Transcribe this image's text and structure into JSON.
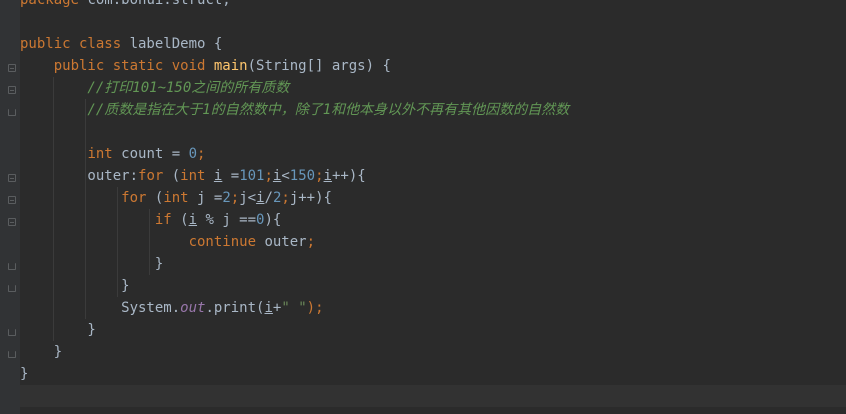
{
  "editor": {
    "lines": [
      [
        {
          "t": "package ",
          "c": "kw"
        },
        {
          "t": "com.bohui.struct;",
          "c": "var"
        }
      ],
      [],
      [
        {
          "t": "public class ",
          "c": "kw"
        },
        {
          "t": "labelDemo {",
          "c": "var"
        }
      ],
      [
        {
          "t": "    public static void ",
          "c": "kw"
        },
        {
          "t": "main",
          "c": "fn"
        },
        {
          "t": "(String[] args) {",
          "c": "var"
        }
      ],
      [
        {
          "t": "        //打印101~150之间的所有质数",
          "c": "cm"
        }
      ],
      [
        {
          "t": "        //质数是指在大于1的自然数中，除了1和他本身以外不再有其他因数的自然数",
          "c": "cm"
        }
      ],
      [],
      [
        {
          "t": "        ",
          "c": "var"
        },
        {
          "t": "int ",
          "c": "kw"
        },
        {
          "t": "count = ",
          "c": "var"
        },
        {
          "t": "0",
          "c": "num"
        },
        {
          "t": ";",
          "c": "kw"
        }
      ],
      [
        {
          "t": "        outer:",
          "c": "var"
        },
        {
          "t": "for ",
          "c": "kw"
        },
        {
          "t": "(",
          "c": "var"
        },
        {
          "t": "int ",
          "c": "kw"
        },
        {
          "t": "i",
          "c": "var ul"
        },
        {
          "t": " =",
          "c": "var"
        },
        {
          "t": "101",
          "c": "num"
        },
        {
          "t": ";",
          "c": "kw"
        },
        {
          "t": "i",
          "c": "var ul"
        },
        {
          "t": "<",
          "c": "var"
        },
        {
          "t": "150",
          "c": "num"
        },
        {
          "t": ";",
          "c": "kw"
        },
        {
          "t": "i",
          "c": "var ul"
        },
        {
          "t": "++){",
          "c": "var"
        }
      ],
      [
        {
          "t": "            ",
          "c": "var"
        },
        {
          "t": "for ",
          "c": "kw"
        },
        {
          "t": "(",
          "c": "var"
        },
        {
          "t": "int ",
          "c": "kw"
        },
        {
          "t": "j =",
          "c": "var"
        },
        {
          "t": "2",
          "c": "num"
        },
        {
          "t": ";",
          "c": "kw"
        },
        {
          "t": "j<",
          "c": "var"
        },
        {
          "t": "i",
          "c": "var ul"
        },
        {
          "t": "/",
          "c": "var"
        },
        {
          "t": "2",
          "c": "num"
        },
        {
          "t": ";",
          "c": "kw"
        },
        {
          "t": "j++){",
          "c": "var"
        }
      ],
      [
        {
          "t": "                ",
          "c": "var"
        },
        {
          "t": "if ",
          "c": "kw"
        },
        {
          "t": "(",
          "c": "var"
        },
        {
          "t": "i",
          "c": "var ul"
        },
        {
          "t": " % j ==",
          "c": "var"
        },
        {
          "t": "0",
          "c": "num"
        },
        {
          "t": "){",
          "c": "var"
        }
      ],
      [
        {
          "t": "                    ",
          "c": "var"
        },
        {
          "t": "continue ",
          "c": "kw"
        },
        {
          "t": "outer",
          "c": "var"
        },
        {
          "t": ";",
          "c": "kw"
        }
      ],
      [
        {
          "t": "                }",
          "c": "var"
        }
      ],
      [
        {
          "t": "            }",
          "c": "var"
        }
      ],
      [
        {
          "t": "            System.",
          "c": "var"
        },
        {
          "t": "out",
          "c": "fld"
        },
        {
          "t": ".print(",
          "c": "var"
        },
        {
          "t": "i",
          "c": "var ul"
        },
        {
          "t": "+",
          "c": "var"
        },
        {
          "t": "\" \"",
          "c": "str"
        },
        {
          "t": ");",
          "c": "kw"
        }
      ],
      [
        {
          "t": "        }",
          "c": "var"
        }
      ],
      [
        {
          "t": "    }",
          "c": "var"
        }
      ],
      [
        {
          "t": "}",
          "c": "var"
        }
      ],
      []
    ]
  }
}
